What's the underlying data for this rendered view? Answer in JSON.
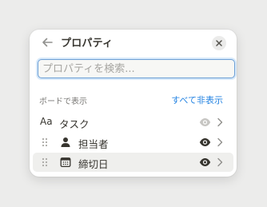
{
  "header": {
    "title": "プロパティ",
    "back_icon": "arrow-left-icon",
    "close_icon": "close-icon"
  },
  "search": {
    "placeholder": "プロパティを検索..."
  },
  "section": {
    "label": "ボードで表示",
    "hide_all": "すべて非表示"
  },
  "properties": [
    {
      "type_label": "Aa",
      "label": "タスク",
      "visible": true,
      "locked": true,
      "icon": "title-type-icon"
    },
    {
      "label": "担当者",
      "visible": true,
      "locked": false,
      "icon": "person-icon"
    },
    {
      "label": "締切日",
      "visible": true,
      "locked": false,
      "icon": "calendar-icon",
      "hovered": true
    }
  ],
  "colors": {
    "accent": "#2383e2",
    "text": "#37352f",
    "muted": "#787774",
    "hover_bg": "#efefed",
    "eye_disabled": "#c7c6c3"
  }
}
